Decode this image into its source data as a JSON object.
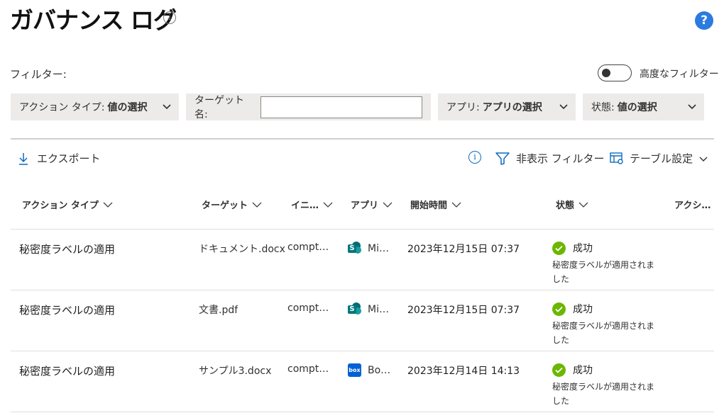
{
  "page": {
    "title": "ガバナンス ログ",
    "info_glyph": "i",
    "help_glyph": "?"
  },
  "filters": {
    "label": "フィルター:",
    "advanced_toggle_label": "高度なフィルター",
    "action_type": {
      "label": "アクション タイプ:",
      "value": "値の選択"
    },
    "target_name": {
      "label": "ターゲット名:",
      "value": ""
    },
    "app": {
      "label": "アプリ:",
      "value": "アプリの選択"
    },
    "state": {
      "label": "状態:",
      "value": "値の選択"
    }
  },
  "toolbar": {
    "export_label": "エクスポート",
    "info_glyph": "i",
    "hide_filter_label": "非表示 フィルター",
    "table_settings_label": "テーブル設定"
  },
  "table": {
    "columns": [
      "アクション タイプ",
      "ターゲット",
      "イニ…",
      "アプリ",
      "開始時間",
      "状態",
      "アクシ…"
    ],
    "rows": [
      {
        "action": "秘密度ラベルの適用",
        "target": "ドキュメント.docx",
        "initiator": "compt…",
        "app_icon": "sharepoint-icon",
        "app": "Mi…",
        "time": "2023年12月15日 07:37",
        "state": "成功",
        "state_desc": "秘密度ラベルが適用されました"
      },
      {
        "action": "秘密度ラベルの適用",
        "target": "文書.pdf",
        "initiator": "compt…",
        "app_icon": "sharepoint-icon",
        "app": "Mi…",
        "time": "2023年12月15日 07:37",
        "state": "成功",
        "state_desc": "秘密度ラベルが適用されました"
      },
      {
        "action": "秘密度ラベルの適用",
        "target": "サンプル3.docx",
        "initiator": "compt…",
        "app_icon": "box-icon",
        "app": "Bo…",
        "time": "2023年12月14日 14:13",
        "state": "成功",
        "state_desc": "秘密度ラベルが適用されました"
      }
    ]
  },
  "icons": {
    "box_text": "box",
    "sharepoint_letter": "S"
  },
  "colors": {
    "accent": "#0f6cbd",
    "help": "#2b7be0",
    "success": "#6bb700",
    "dropdown_bg": "#edebe9"
  }
}
